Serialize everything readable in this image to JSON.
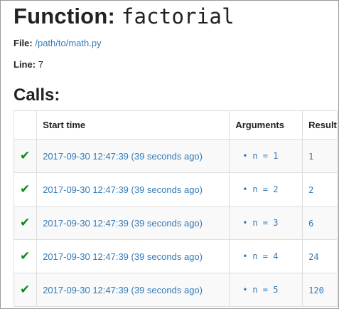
{
  "header": {
    "title_prefix": "Function:",
    "function_name": "factorial"
  },
  "meta": {
    "file_label": "File:",
    "file_path": "/path/to/math.py",
    "line_label": "Line:",
    "line_value": "7"
  },
  "calls": {
    "heading": "Calls:",
    "columns": [
      "",
      "Start time",
      "Arguments",
      "Result"
    ],
    "status_icon": "check-icon",
    "status_color": "#0a8a16",
    "link_color": "#337ab7",
    "rows": [
      {
        "start_time": "2017-09-30 12:47:39 (39 seconds ago)",
        "argument": "n = 1",
        "result": "1"
      },
      {
        "start_time": "2017-09-30 12:47:39 (39 seconds ago)",
        "argument": "n = 2",
        "result": "2"
      },
      {
        "start_time": "2017-09-30 12:47:39 (39 seconds ago)",
        "argument": "n = 3",
        "result": "6"
      },
      {
        "start_time": "2017-09-30 12:47:39 (39 seconds ago)",
        "argument": "n = 4",
        "result": "24"
      },
      {
        "start_time": "2017-09-30 12:47:39 (39 seconds ago)",
        "argument": "n = 5",
        "result": "120"
      }
    ]
  }
}
